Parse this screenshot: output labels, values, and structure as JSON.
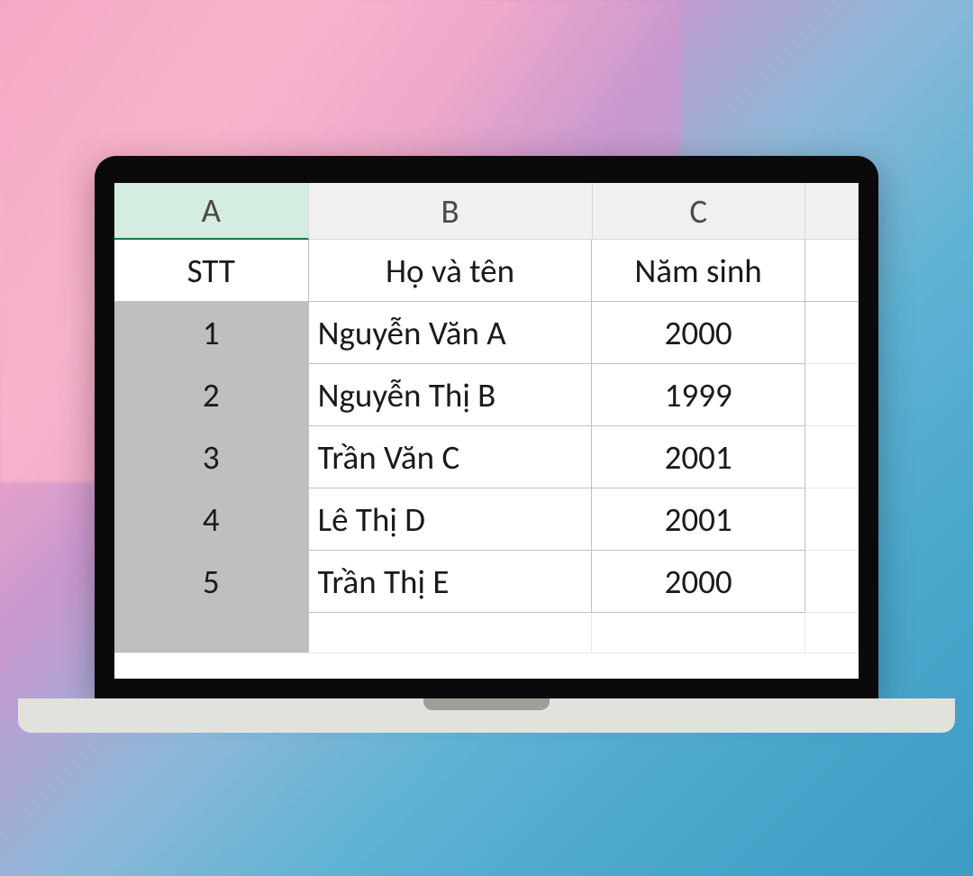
{
  "spreadsheet": {
    "column_headers": [
      "A",
      "B",
      "C"
    ],
    "selected_column": "A",
    "headers": {
      "stt": "STT",
      "name": "Họ và tên",
      "year": "Năm sinh"
    },
    "rows": [
      {
        "stt": "1",
        "name": "Nguyễn Văn A",
        "year": "2000"
      },
      {
        "stt": "2",
        "name": "Nguyễn Thị B",
        "year": "1999"
      },
      {
        "stt": "3",
        "name": "Trần Văn C",
        "year": "2001"
      },
      {
        "stt": "4",
        "name": "Lê Thị D",
        "year": "2001"
      },
      {
        "stt": "5",
        "name": "Trần Thị E",
        "year": "2000"
      }
    ]
  }
}
